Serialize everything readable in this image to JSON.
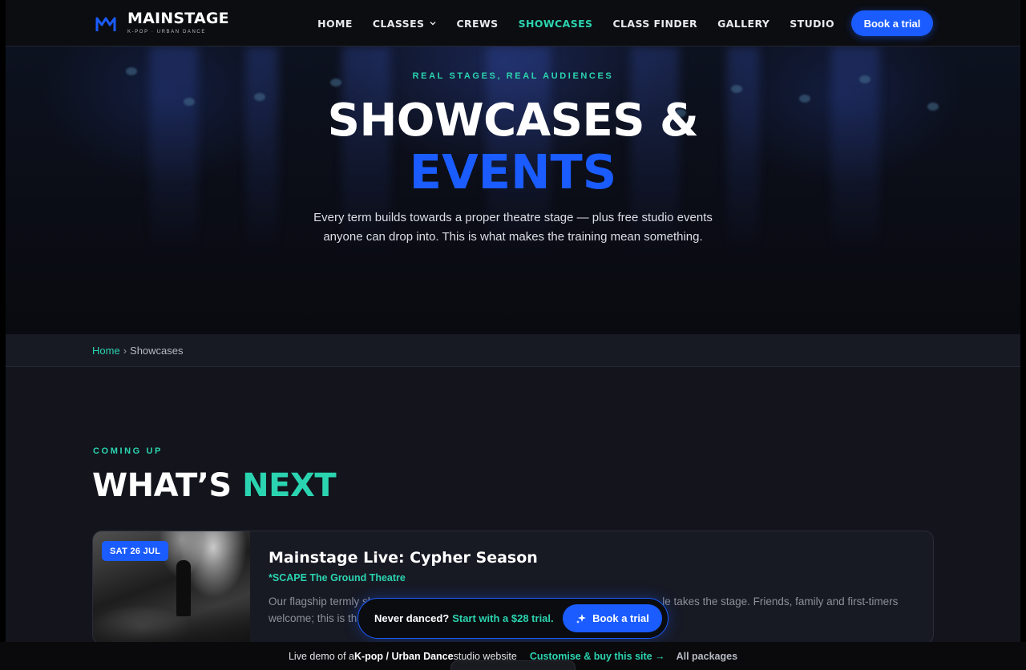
{
  "brand": {
    "name": "MAINSTAGE",
    "tagline": "K-POP · URBAN DANCE",
    "accent_blue": "#1a5cff",
    "accent_teal": "#2bd4b0"
  },
  "nav": {
    "items": [
      {
        "label": "HOME"
      },
      {
        "label": "CLASSES",
        "icon": "chevron-down-icon"
      },
      {
        "label": "CREWS"
      },
      {
        "label": "SHOWCASES",
        "active": true
      },
      {
        "label": "CLASS FINDER"
      },
      {
        "label": "GALLERY"
      },
      {
        "label": "STUDIO"
      }
    ],
    "cta": "Book a trial"
  },
  "hero": {
    "kicker": "REAL STAGES, REAL AUDIENCES",
    "title_line1": "SHOWCASES &",
    "title_line2": "EVENTS",
    "subtitle": "Every term builds towards a proper theatre stage — plus free studio events anyone can drop into. This is what makes the training mean something."
  },
  "breadcrumb": {
    "home": "Home",
    "separator": "›",
    "current": "Showcases"
  },
  "next": {
    "kicker": "COMING UP",
    "title_main": "WHAT’S ",
    "title_accent": "NEXT",
    "events": [
      {
        "date": "SAT 26 JUL",
        "title": "Mainstage Live: Cypher Season",
        "venue": "*SCAPE The Ground Theatre",
        "description_start": "Our flagship termly sh",
        "description_end": "le takes the stage. Friends, family and first-timers welcome; this is th"
      }
    ]
  },
  "promo_pill": {
    "question": "Never danced?",
    "offer": "Start with a $28 trial.",
    "button": "Book a trial",
    "icon": "sparkle-icon"
  },
  "demo_bar": {
    "prefix": "Live demo of a ",
    "category": "K-pop / Urban Dance",
    "suffix": " studio website",
    "link": "Customise & buy this site →",
    "packages": "All packages"
  }
}
